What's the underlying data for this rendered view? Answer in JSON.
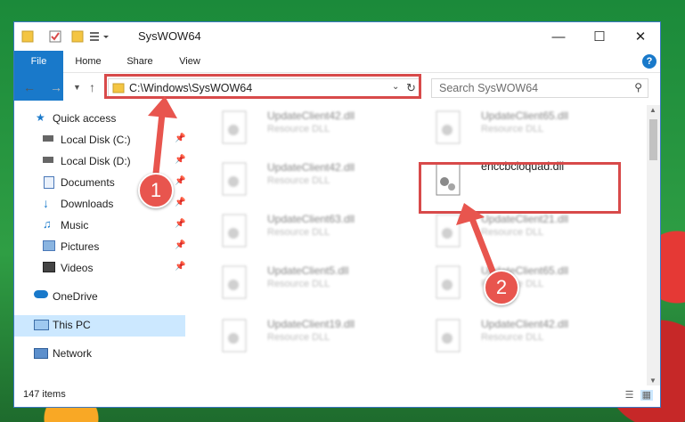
{
  "window": {
    "title": "SysWOW64"
  },
  "ribbon": {
    "tabs": [
      "File",
      "Home",
      "Share",
      "View"
    ],
    "help": "?"
  },
  "address": {
    "path": "C:\\Windows\\SysWOW64"
  },
  "search": {
    "placeholder": "Search SysWOW64"
  },
  "sidebar": {
    "items": [
      {
        "label": "Quick access",
        "icon": "star-icon"
      },
      {
        "label": "Local Disk (C:)",
        "icon": "drive-icon",
        "pinned": true
      },
      {
        "label": "Local Disk (D:)",
        "icon": "drive-icon",
        "pinned": true
      },
      {
        "label": "Documents",
        "icon": "documents-icon",
        "pinned": true
      },
      {
        "label": "Downloads",
        "icon": "download-icon",
        "pinned": true
      },
      {
        "label": "Music",
        "icon": "music-icon",
        "pinned": true
      },
      {
        "label": "Pictures",
        "icon": "pictures-icon",
        "pinned": true
      },
      {
        "label": "Videos",
        "icon": "videos-icon",
        "pinned": true
      },
      {
        "label": "OneDrive",
        "icon": "cloud-icon"
      },
      {
        "label": "This PC",
        "icon": "computer-icon",
        "selected": true
      },
      {
        "label": "Network",
        "icon": "network-icon"
      }
    ]
  },
  "files": [
    {
      "name": "UpdateClient42.dll",
      "type": "Resource DLL"
    },
    {
      "name": "UpdateClient65.dll",
      "type": "Resource DLL"
    },
    {
      "name": "UpdateClient42.dll",
      "type": "Resource DLL"
    },
    {
      "name": "enccbcioquad.dll",
      "type": ""
    },
    {
      "name": "UpdateClient63.dll",
      "type": "Resource DLL"
    },
    {
      "name": "UpdateClient21.dll",
      "type": "Resource DLL"
    },
    {
      "name": "UpdateClient5.dll",
      "type": "Resource DLL"
    },
    {
      "name": "UpdateClient65.dll",
      "type": "Resource DLL"
    },
    {
      "name": "UpdateClient19.dll",
      "type": "Resource DLL"
    },
    {
      "name": "UpdateClient42.dll",
      "type": "Resource DLL"
    }
  ],
  "status": {
    "item_count": "147 items"
  },
  "annotations": {
    "step1": "1",
    "step2": "2"
  },
  "colors": {
    "accent": "#1979ca",
    "highlight": "#d84a4a"
  }
}
